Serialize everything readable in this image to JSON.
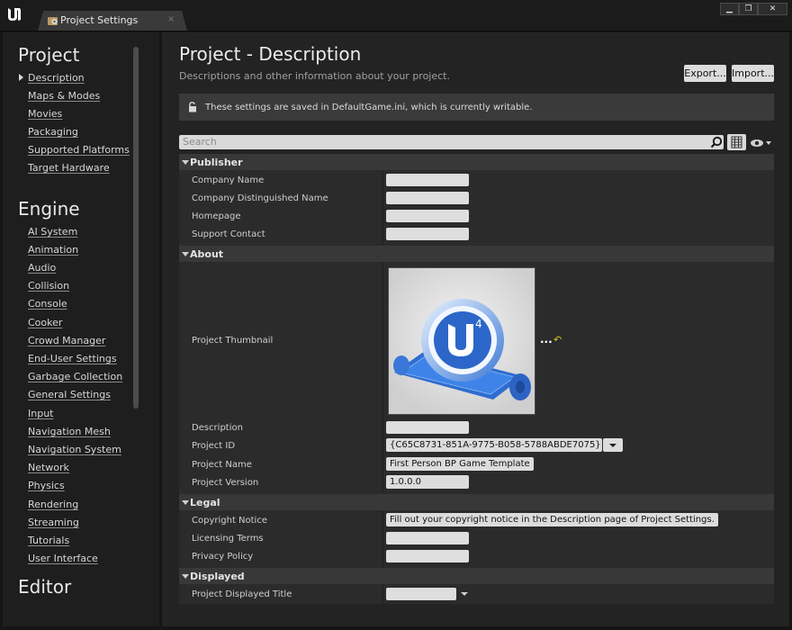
{
  "window": {
    "tab_label": "Project Settings",
    "tab_close": "×",
    "buttons": [
      "▁",
      "❐",
      "✕"
    ]
  },
  "sidebar": {
    "project": {
      "heading": "Project",
      "items": [
        "Description",
        "Maps & Modes",
        "Movies",
        "Packaging",
        "Supported Platforms",
        "Target Hardware"
      ]
    },
    "engine": {
      "heading": "Engine",
      "items": [
        "AI System",
        "Animation",
        "Audio",
        "Collision",
        "Console",
        "Cooker",
        "Crowd Manager",
        "End-User Settings",
        "Garbage Collection",
        "General Settings",
        "Input",
        "Navigation Mesh",
        "Navigation System",
        "Network",
        "Physics",
        "Rendering",
        "Streaming",
        "Tutorials",
        "User Interface"
      ]
    },
    "editor": {
      "heading": "Editor"
    }
  },
  "main": {
    "title": "Project - Description",
    "subtitle": "Descriptions and other information about your project.",
    "export_label": "Export...",
    "import_label": "Import...",
    "notice": "These settings are saved in DefaultGame.ini, which is currently writable.",
    "search_placeholder": "Search"
  },
  "sections": {
    "publisher": {
      "title": "Publisher",
      "rows": [
        "Company Name",
        "Company Distinguished Name",
        "Homepage",
        "Support Contact"
      ]
    },
    "about": {
      "title": "About",
      "thumbnail_label": "Project Thumbnail",
      "thumbnail_more": "...",
      "thumbnail_reset": "↶",
      "description_label": "Description",
      "project_id_label": "Project ID",
      "project_id_value": "{C65C8731-851A-9775-B058-5788ABDE7075}",
      "project_name_label": "Project Name",
      "project_name_value": "First Person BP Game Template",
      "project_version_label": "Project Version",
      "project_version_value": "1.0.0.0"
    },
    "legal": {
      "title": "Legal",
      "copyright_label": "Copyright Notice",
      "copyright_value": "Fill out your copyright notice in the Description page of Project Settings.",
      "licensing_label": "Licensing Terms",
      "privacy_label": "Privacy Policy"
    },
    "displayed": {
      "title": "Displayed",
      "display_title_label": "Project Displayed Title"
    }
  },
  "colors": {
    "background": "#151515",
    "panel": "#232323",
    "grid": "#2b2b2b",
    "section_header": "#383838",
    "field": "#dedede"
  }
}
